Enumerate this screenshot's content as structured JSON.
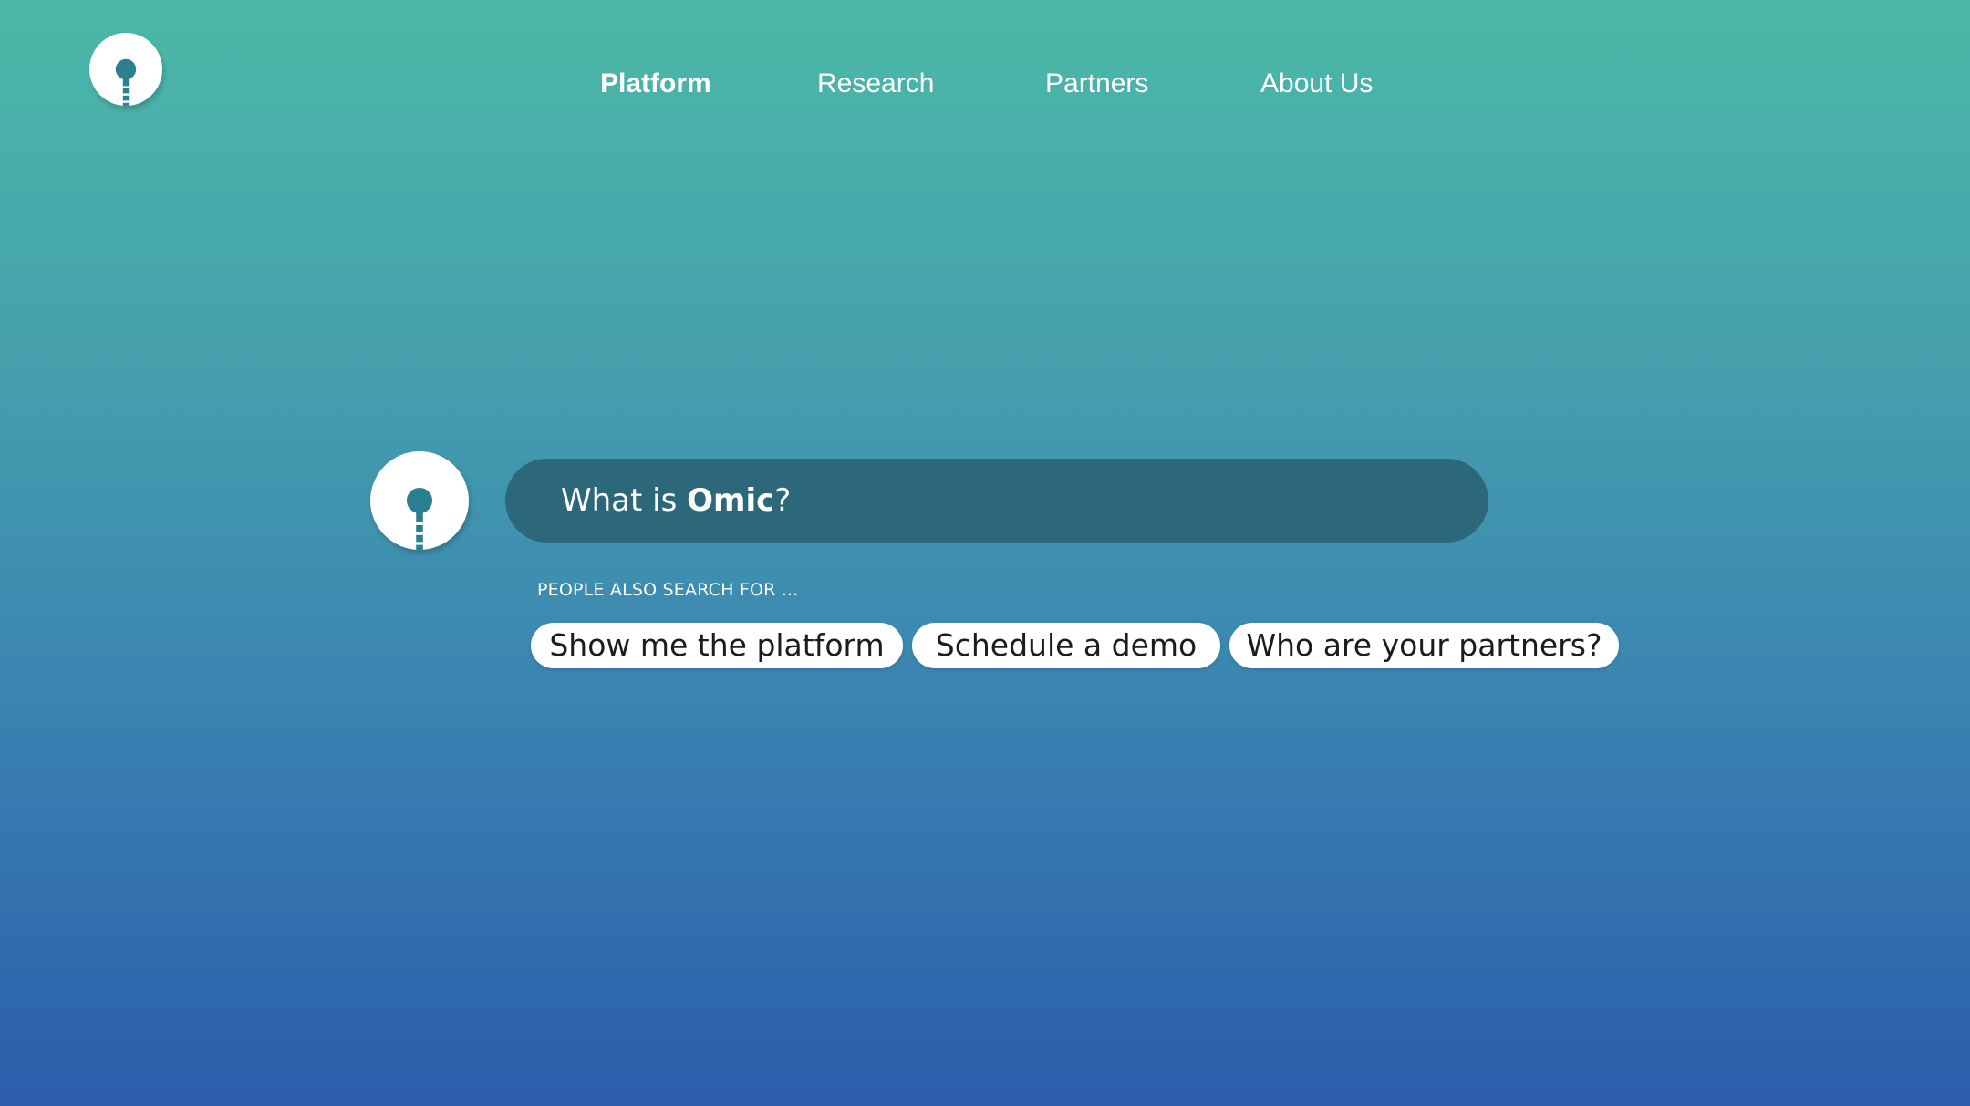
{
  "header": {
    "logo_icon": "omic-logo-icon",
    "nav": [
      {
        "label": "Platform",
        "active": true
      },
      {
        "label": "Research",
        "active": false
      },
      {
        "label": "Partners",
        "active": false
      },
      {
        "label": "About Us",
        "active": false
      }
    ]
  },
  "assistant": {
    "avatar_icon": "omic-logo-icon",
    "query": {
      "prefix": "What is ",
      "emphasis": "Omic",
      "suffix": "?"
    }
  },
  "suggestions": {
    "label": "PEOPLE ALSO SEARCH FOR ...",
    "chips": [
      "Show me the platform",
      "Schedule a demo",
      "Who are your partners?"
    ]
  },
  "colors": {
    "gradient_top": "#4bb9a8",
    "gradient_bottom": "#2b5dab",
    "search_bar": "#2c6879",
    "logo_mark": "#2b7f8e",
    "chip_background": "#ffffff"
  }
}
